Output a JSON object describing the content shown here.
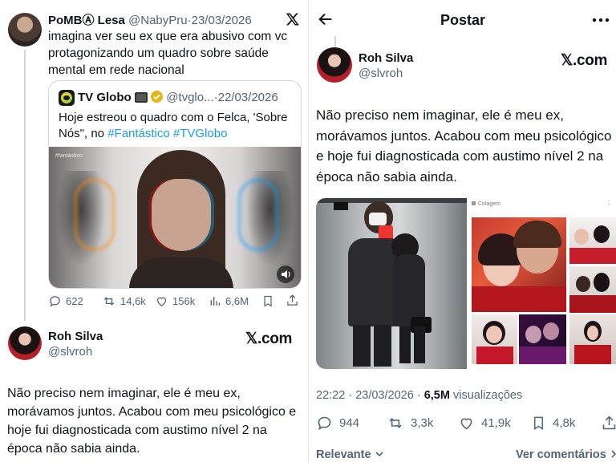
{
  "left": {
    "top_post": {
      "name": "PoMBⒶ Lesa",
      "handle": "@NabyPru",
      "sep": "·",
      "date": "23/03/2026",
      "text": "imagina ver seu ex que era abusivo com vc protagonizando um quadro sobre saúde mental em rede nacional",
      "brand_icon": "x-logo-icon"
    },
    "quote": {
      "name": "TV Globo",
      "handle": "@tvglo...",
      "sep": "·",
      "date": "22/03/2026",
      "text_plain": "Hoje estreou o quadro com o Felca, 'Sobre Nós\", no ",
      "hashtag1": "#Fantástico",
      "hashtag2": "#TVGlobo",
      "image_watermark": "#fantástico"
    },
    "stats": {
      "replies": "622",
      "reposts": "14,6k",
      "likes": "156k",
      "views": "6,6M"
    },
    "footer_post": {
      "name": "Roh Silva",
      "handle": "@slvroh",
      "brand": "𝕏.com",
      "text": "Não preciso nem imaginar, ele é meu ex, morávamos juntos. Acabou com meu psicológico e hoje fui diagnosticada com austimo nível 2 na época não sabia ainda."
    }
  },
  "right": {
    "header": {
      "title": "Postar",
      "back_icon": "arrow-left-icon",
      "more_icon": "more-horizontal-icon"
    },
    "post": {
      "name": "Roh Silva",
      "handle": "@slvroh",
      "brand": "𝕏.com",
      "text": "Não preciso nem imaginar, ele é meu ex, morávamos juntos. Acabou com meu psicológico e hoje fui diagnosticada com austimo nível 2 na época não sabia ainda.",
      "collage_label": "Colagem"
    },
    "meta": {
      "time": "22:22",
      "sep": "·",
      "date": "23/03/2026",
      "sep2": "·",
      "views": "6,5M",
      "views_label": "visualizações"
    },
    "stats": {
      "replies": "944",
      "reposts": "3,3k",
      "likes": "41,9k",
      "bookmarks": "4,8k"
    },
    "footer": {
      "sort_label": "Relevante",
      "see_replies": "Ver comentários"
    }
  },
  "colors": {
    "text": "#0f1419",
    "muted": "#536471",
    "link": "#1d9bf0",
    "verified_gold": "#e2b719",
    "border": "#cfd9de"
  }
}
